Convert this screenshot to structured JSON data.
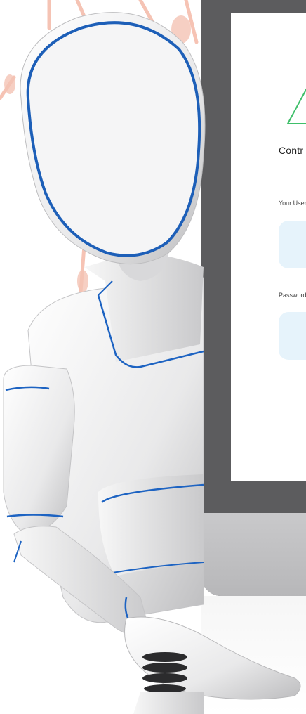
{
  "login_form": {
    "title": "Contr",
    "username_label": "Your User",
    "password_label": "Password",
    "username_value": "",
    "password_value": ""
  },
  "colors": {
    "bezel": "#5c5c5e",
    "chin": "#c2c2c4",
    "input_bg": "#e6f3fb",
    "logo_stroke": "#3fbf6a",
    "robot_accent": "#1d63c2",
    "background_decor": "#f4b9a7"
  },
  "icons": [
    "logo-triangle-icon"
  ]
}
